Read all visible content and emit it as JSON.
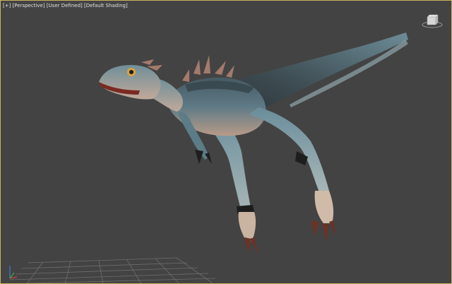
{
  "viewport": {
    "label_plus": "[+]",
    "label_view": "[Perspective]",
    "label_camera": "[User Defined]",
    "label_shading": "[Default Shading]"
  },
  "colors": {
    "background": "#434343",
    "border_active": "#c8b45a",
    "grid_line": "#6e6e6e",
    "model_skin": "#5b7d8a",
    "model_underbelly": "#b99a86"
  },
  "icons": {
    "viewcube": "viewcube-icon",
    "axis": "axis-tripod-icon"
  }
}
